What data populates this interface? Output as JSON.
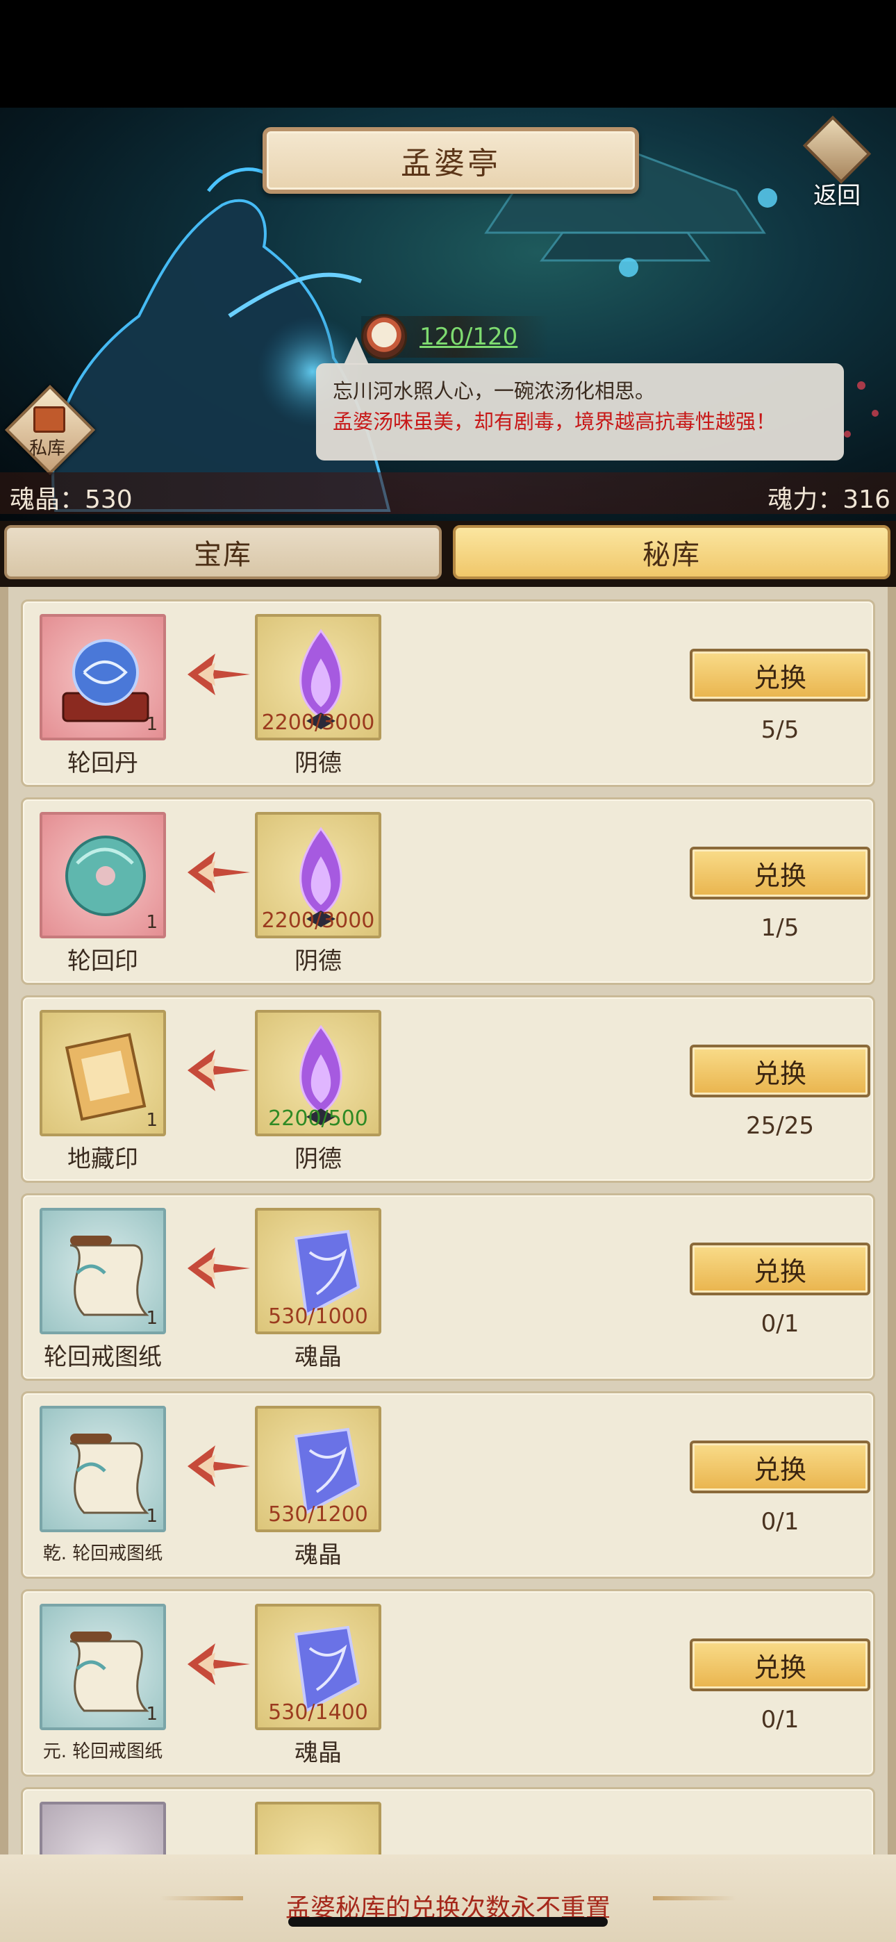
{
  "header": {
    "title": "孟婆亭",
    "back_label": "返回"
  },
  "npc": {
    "counter": "120/120",
    "line1": "忘川河水照人心，一碗浓汤化相思。",
    "line2": "孟婆汤味虽美，却有剧毒，境界越高抗毒性越强！"
  },
  "private_store": {
    "label": "私库"
  },
  "stats": {
    "soul_crystal": "魂晶：530",
    "soul_power": "魂力：316"
  },
  "tabs": [
    {
      "label": "宝库",
      "active": false
    },
    {
      "label": "秘库",
      "active": true
    }
  ],
  "items": [
    {
      "name": "轮回丹",
      "qty": "1",
      "cost_name": "阴德",
      "cost": "2200/3000",
      "button": "兑换",
      "count": "5/5",
      "frame": "pink",
      "cost_color": "red",
      "icon": "orb-icon",
      "cost_icon": "purple-flame-icon"
    },
    {
      "name": "轮回印",
      "qty": "1",
      "cost_name": "阴德",
      "cost": "2200/3000",
      "button": "兑换",
      "count": "1/5",
      "frame": "pink",
      "cost_color": "red",
      "icon": "jade-disc-icon",
      "cost_icon": "purple-flame-icon"
    },
    {
      "name": "地藏印",
      "qty": "1",
      "cost_name": "阴德",
      "cost": "2200/500",
      "button": "兑换",
      "count": "25/25",
      "frame": "gold",
      "cost_color": "green",
      "icon": "golden-seal-icon",
      "cost_icon": "purple-flame-icon"
    },
    {
      "name": "轮回戒图纸",
      "qty": "1",
      "cost_name": "魂晶",
      "cost": "530/1000",
      "button": "兑换",
      "count": "0/1",
      "frame": "teal",
      "cost_color": "red",
      "icon": "scroll-icon",
      "cost_icon": "soul-crystal-icon"
    },
    {
      "name": "乾. 轮回戒图纸",
      "qty": "1",
      "cost_name": "魂晶",
      "cost": "530/1200",
      "button": "兑换",
      "count": "0/1",
      "frame": "teal",
      "cost_color": "red",
      "icon": "scroll-icon",
      "cost_icon": "soul-crystal-icon"
    },
    {
      "name": "元. 轮回戒图纸",
      "qty": "1",
      "cost_name": "魂晶",
      "cost": "530/1400",
      "button": "兑换",
      "count": "0/1",
      "frame": "teal",
      "cost_color": "red",
      "icon": "scroll-icon",
      "cost_icon": "soul-crystal-icon"
    }
  ],
  "footer": {
    "note": "孟婆秘库的兑换次数永不重置"
  }
}
